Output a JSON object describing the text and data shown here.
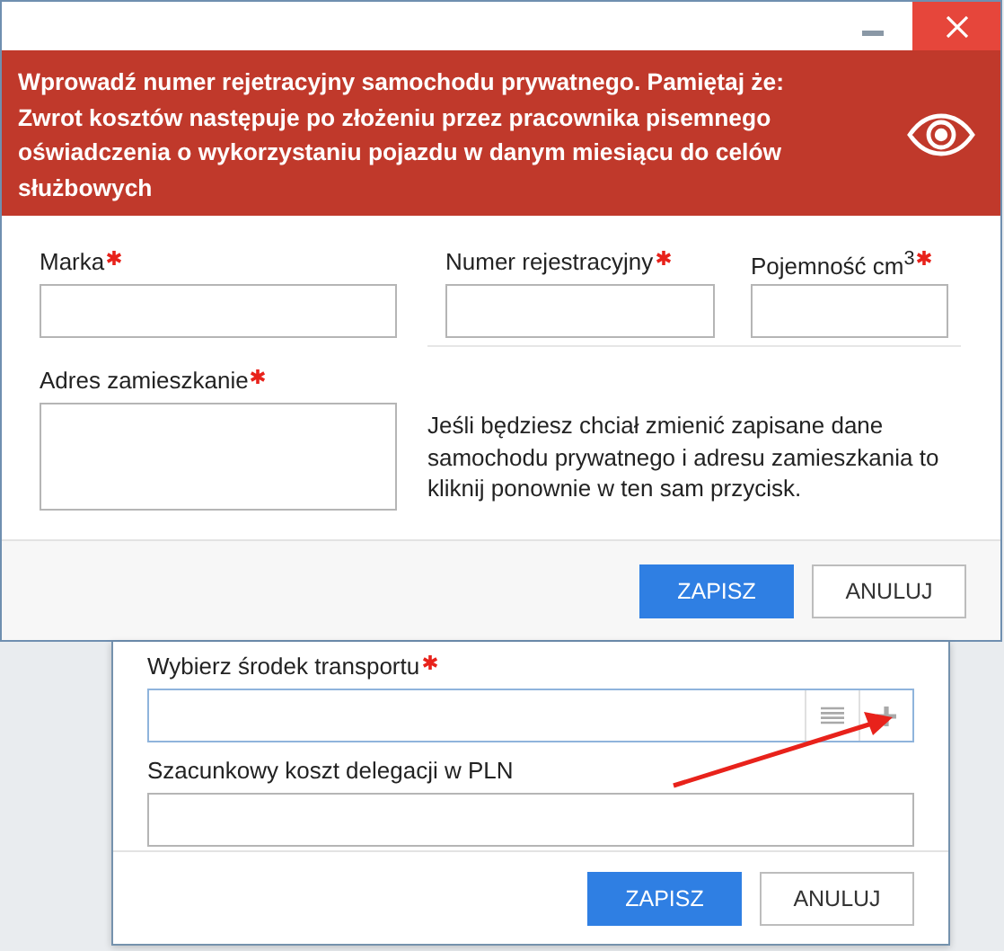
{
  "dialog": {
    "banner": "Wprowadź numer rejetracyjny samochodu prywatnego. Pamiętaj że: Zwrot kosztów następuje po złożeniu przez pracownika pisemnego oświadczenia o wykorzystaniu pojazdu w danym miesiącu do celów służbowych",
    "fields": [
      {
        "label": "Marka",
        "required": true,
        "kind": "input"
      },
      {
        "label": "Numer rejestracyjny",
        "required": true,
        "kind": "input"
      },
      {
        "label": "Pojemność cm$^{3}$",
        "required": true,
        "kind": "input"
      },
      {
        "label": "Adres zamieszkanie",
        "required": true,
        "kind": "textarea"
      }
    ],
    "note": "Jeśli będziesz chciał zmienić zapisane dane samochodu prywatnego i adresu zamieszkania to kliknij ponownie w ten sam przycisk.",
    "buttons": [
      {
        "label": "ZAPISZ",
        "kind": "primary"
      },
      {
        "label": "ANULUJ",
        "kind": "secondary"
      }
    ]
  },
  "back_dialog": {
    "fields": [
      {
        "label": "Wybierz środek transportu",
        "required": true,
        "kind": "combo"
      },
      {
        "label": "Szacunkowy koszt delegacji w PLN",
        "required": false,
        "kind": "input"
      }
    ],
    "buttons": [
      {
        "label": "ZAPISZ",
        "kind": "primary"
      },
      {
        "label": "ANULUJ",
        "kind": "secondary"
      }
    ]
  }
}
